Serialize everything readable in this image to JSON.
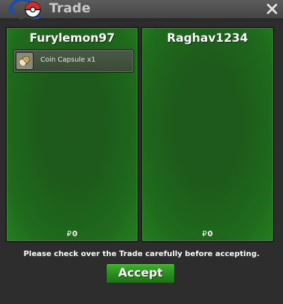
{
  "window": {
    "title": "Trade",
    "close_symbol": "×"
  },
  "trade": {
    "left_player": {
      "name": "Furylemon97",
      "items": [
        {
          "label": "Coin Capsule  x1",
          "icon": "coin-capsule-icon"
        }
      ],
      "money_symbol": "₽",
      "money": "0"
    },
    "right_player": {
      "name": "Raghav1234",
      "items": [],
      "money_symbol": "₽",
      "money": "0"
    }
  },
  "notice": "Please check over the Trade carefully before accepting.",
  "accept_label": "Accept",
  "colors": {
    "panel_green": "#1f6a1c",
    "accept_green": "#2a8a1e",
    "titlebar": "#4d4d4d"
  }
}
